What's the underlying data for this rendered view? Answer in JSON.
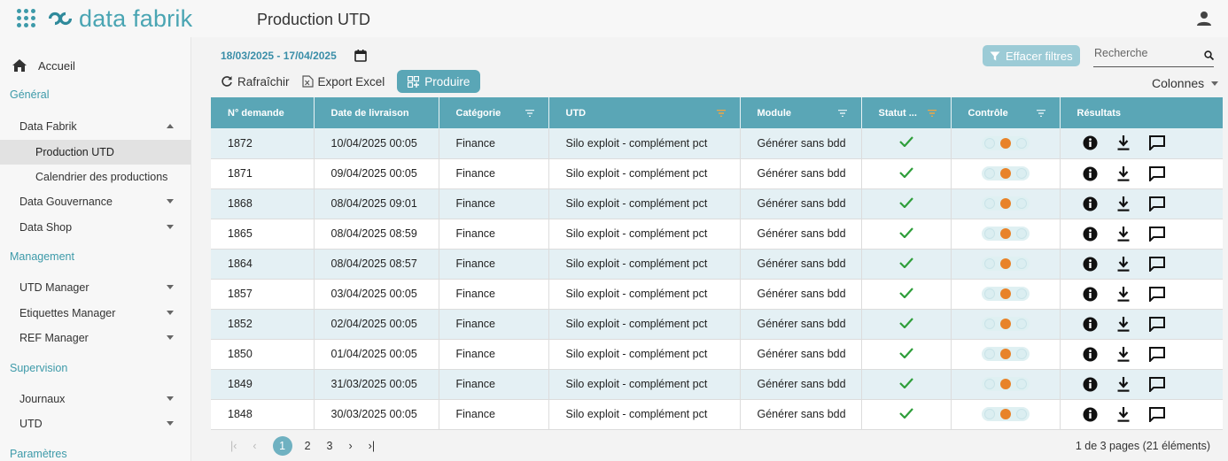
{
  "brand": {
    "name": "data fabrik",
    "icon": "grid-apps-icon"
  },
  "header": {
    "title": "Production UTD",
    "user_icon": "user-icon"
  },
  "sidebar": {
    "home": "Accueil",
    "sections": {
      "general": "Général",
      "management": "Management",
      "supervision": "Supervision",
      "parametres": "Paramètres"
    },
    "items": {
      "data_fabrik": "Data Fabrik",
      "production_utd": "Production UTD",
      "calendrier": "Calendrier des productions",
      "data_gouvernance": "Data Gouvernance",
      "data_shop": "Data Shop",
      "utd_manager": "UTD Manager",
      "etiquettes_manager": "Etiquettes Manager",
      "ref_manager": "REF Manager",
      "journaux": "Journaux",
      "utd": "UTD"
    }
  },
  "filters": {
    "date_range": "18/03/2025 - 17/04/2025",
    "clear_label": "Effacer filtres",
    "search_placeholder": "Recherche"
  },
  "toolbar": {
    "refresh": "Rafraîchir",
    "export": "Export Excel",
    "produce": "Produire",
    "columns": "Colonnes"
  },
  "table": {
    "headers": [
      "N° demande",
      "Date de livraison",
      "Catégorie",
      "UTD",
      "Module",
      "Statut ...",
      "Contrôle",
      "Résultats"
    ],
    "rows": [
      {
        "id": "1872",
        "date": "10/04/2025 00:05",
        "cat": "Finance",
        "utd": "Silo exploit - complément pct",
        "module": "Générer sans bdd"
      },
      {
        "id": "1871",
        "date": "09/04/2025 00:05",
        "cat": "Finance",
        "utd": "Silo exploit - complément pct",
        "module": "Générer sans bdd"
      },
      {
        "id": "1868",
        "date": "08/04/2025 09:01",
        "cat": "Finance",
        "utd": "Silo exploit - complément pct",
        "module": "Générer sans bdd"
      },
      {
        "id": "1865",
        "date": "08/04/2025 08:59",
        "cat": "Finance",
        "utd": "Silo exploit - complément pct",
        "module": "Générer sans bdd"
      },
      {
        "id": "1864",
        "date": "08/04/2025 08:57",
        "cat": "Finance",
        "utd": "Silo exploit - complément pct",
        "module": "Générer sans bdd"
      },
      {
        "id": "1857",
        "date": "03/04/2025 00:05",
        "cat": "Finance",
        "utd": "Silo exploit - complément pct",
        "module": "Générer sans bdd"
      },
      {
        "id": "1852",
        "date": "02/04/2025 00:05",
        "cat": "Finance",
        "utd": "Silo exploit - complément pct",
        "module": "Générer sans bdd"
      },
      {
        "id": "1850",
        "date": "01/04/2025 00:05",
        "cat": "Finance",
        "utd": "Silo exploit - complément pct",
        "module": "Générer sans bdd"
      },
      {
        "id": "1849",
        "date": "31/03/2025 00:05",
        "cat": "Finance",
        "utd": "Silo exploit - complément pct",
        "module": "Générer sans bdd"
      },
      {
        "id": "1848",
        "date": "30/03/2025 00:05",
        "cat": "Finance",
        "utd": "Silo exploit - complément pct",
        "module": "Générer sans bdd"
      }
    ]
  },
  "pagination": {
    "pages": [
      "1",
      "2",
      "3"
    ],
    "current": "1",
    "info": "1 de 3 pages (21 éléments)"
  },
  "colors": {
    "accent": "#5aa6b6",
    "row_alt": "#e4f0f4",
    "status_ok": "#2e9e3a",
    "control_dot": "#e8832a"
  }
}
